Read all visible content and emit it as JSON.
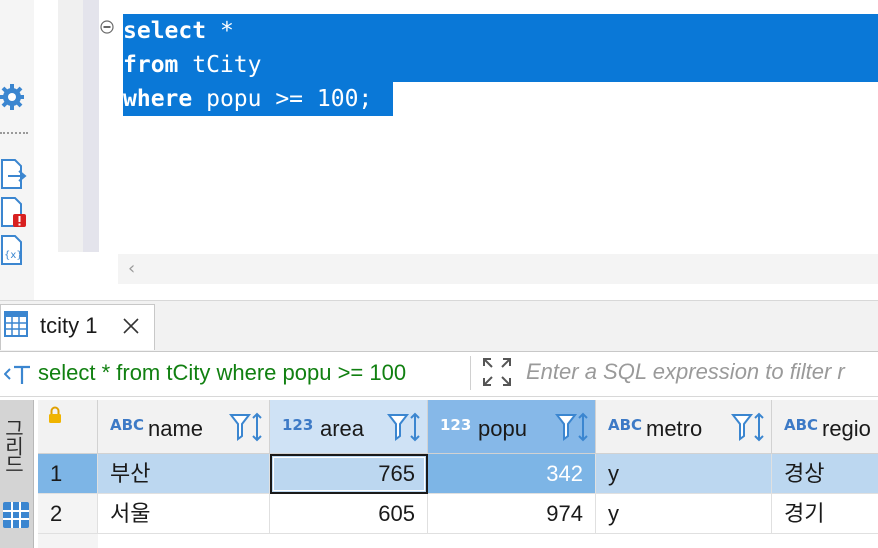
{
  "editor": {
    "lines": [
      {
        "keyword": "select",
        "rest": " *"
      },
      {
        "keyword": "from",
        "rest": " tCity"
      },
      {
        "keyword": "where",
        "rest": " popu >= 100;"
      }
    ]
  },
  "left_toolbar": {
    "icons": [
      "gear-icon",
      "export-icon",
      "problem-icon",
      "variables-icon"
    ]
  },
  "results": {
    "tab_label": "tcity 1",
    "filter_query": "select * from tCity where popu >= 100",
    "filter_placeholder": "Enter a SQL expression to filter r",
    "side_tab_label": "그리드",
    "columns": [
      {
        "type": "ABC",
        "name": "name"
      },
      {
        "type": "123",
        "name": "area"
      },
      {
        "type": "123",
        "name": "popu"
      },
      {
        "type": "ABC",
        "name": "metro"
      },
      {
        "type": "ABC",
        "name": "regio"
      }
    ],
    "rows": [
      {
        "num": "1",
        "name": "부산",
        "area": "765",
        "popu": "342",
        "metro": "y",
        "region": "경상"
      },
      {
        "num": "2",
        "name": "서울",
        "area": "605",
        "popu": "974",
        "metro": "y",
        "region": "경기"
      }
    ]
  },
  "colors": {
    "selection": "#0a78d7",
    "selected_row": "#bcd7f0",
    "selected_column": "#86b8e8",
    "filter_text": "#118011",
    "type_badge": "#3d7ac6"
  }
}
